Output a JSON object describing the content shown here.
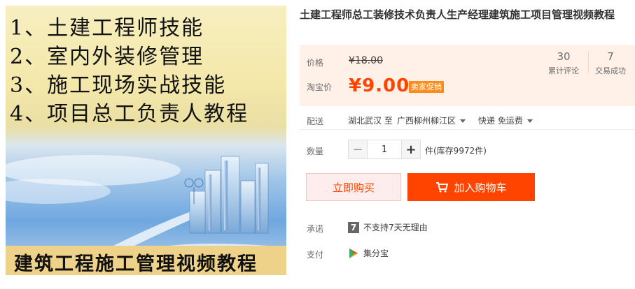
{
  "product": {
    "cover_lines": [
      "1、土建工程师技能",
      "2、室内外装修管理",
      "3、施工现场实战技能",
      "4、项目总工负责人教程"
    ],
    "cover_bottom": "建筑工程施工管理视频教程",
    "title": "土建工程师总工装修技术负责人生产经理建筑施工项目管理视频教程"
  },
  "price": {
    "label": "价格",
    "original": "¥18.00",
    "promo_label": "淘宝价",
    "promo": "¥9.00",
    "promo_badge": "卖家促销"
  },
  "stats": [
    {
      "num": "30",
      "label": "累计评论"
    },
    {
      "num": "7",
      "label": "交易成功"
    }
  ],
  "shipping": {
    "label": "配送",
    "from": "湖北武汉 至",
    "to": "广西柳州柳江区",
    "method": "快递 免运费"
  },
  "quantity": {
    "label": "数量",
    "value": "1",
    "minus": "−",
    "plus": "+",
    "stock": "件(库存9972件)"
  },
  "buttons": {
    "buy_now": "立即购买",
    "add_cart": "加入购物车"
  },
  "promise": {
    "label": "承诺",
    "icon_text": "7",
    "text": "不支持7天无理由"
  },
  "payment": {
    "label": "支付",
    "text": "集分宝"
  },
  "colors": {
    "accent": "#ff4400",
    "price_bg": "#fff1e8",
    "badge": "#ff8c1a"
  }
}
